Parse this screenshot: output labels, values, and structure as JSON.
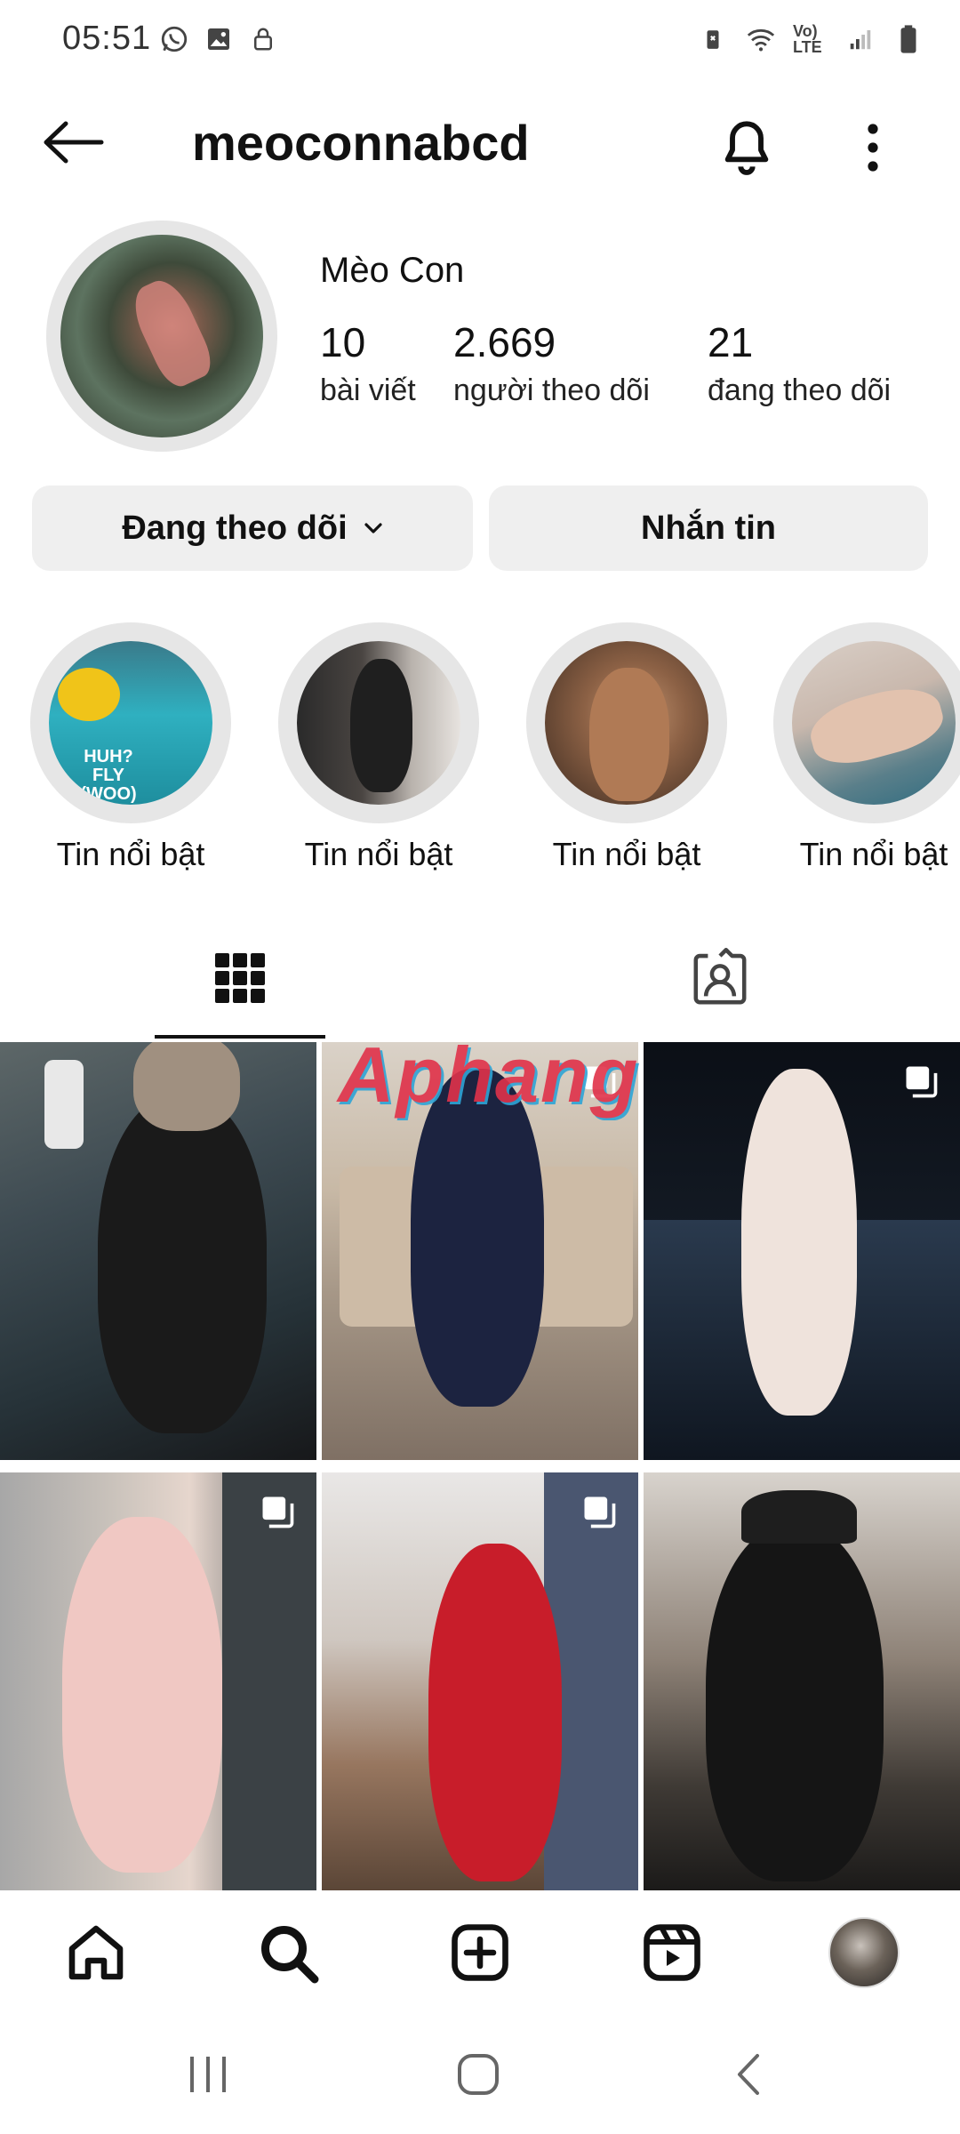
{
  "status_bar": {
    "time": "05:51",
    "network_label": "Vo) LTE"
  },
  "header": {
    "username": "meoconnabcd"
  },
  "profile": {
    "display_name": "Mèo Con",
    "stats": {
      "posts_count": "10",
      "posts_label": "bài viết",
      "followers_count": "2.669",
      "followers_label": "người theo dõi",
      "following_count": "21",
      "following_label": "đang theo dõi"
    }
  },
  "actions": {
    "following_label": "Đang theo dõi",
    "message_label": "Nhắn tin"
  },
  "highlights": [
    {
      "label": "Tin nổi bật",
      "caption": "HUH? FLY (WOO)"
    },
    {
      "label": "Tin nổi bật"
    },
    {
      "label": "Tin nổi bật"
    },
    {
      "label": "Tin nổi bật"
    }
  ],
  "watermark": "Aphang",
  "colors": {
    "accent": "#111111",
    "button_bg": "#efefef",
    "ring": "#e6e6e6"
  },
  "icons": {
    "header": [
      "back-arrow-icon",
      "bell-icon",
      "more-vertical-icon"
    ],
    "tabs": [
      "grid-icon",
      "tagged-icon"
    ],
    "bottom_nav": [
      "home-icon",
      "search-icon",
      "create-icon",
      "reels-icon",
      "profile-avatar"
    ],
    "system_nav": [
      "recents-icon",
      "home-circle-icon",
      "back-chevron-icon"
    ]
  }
}
